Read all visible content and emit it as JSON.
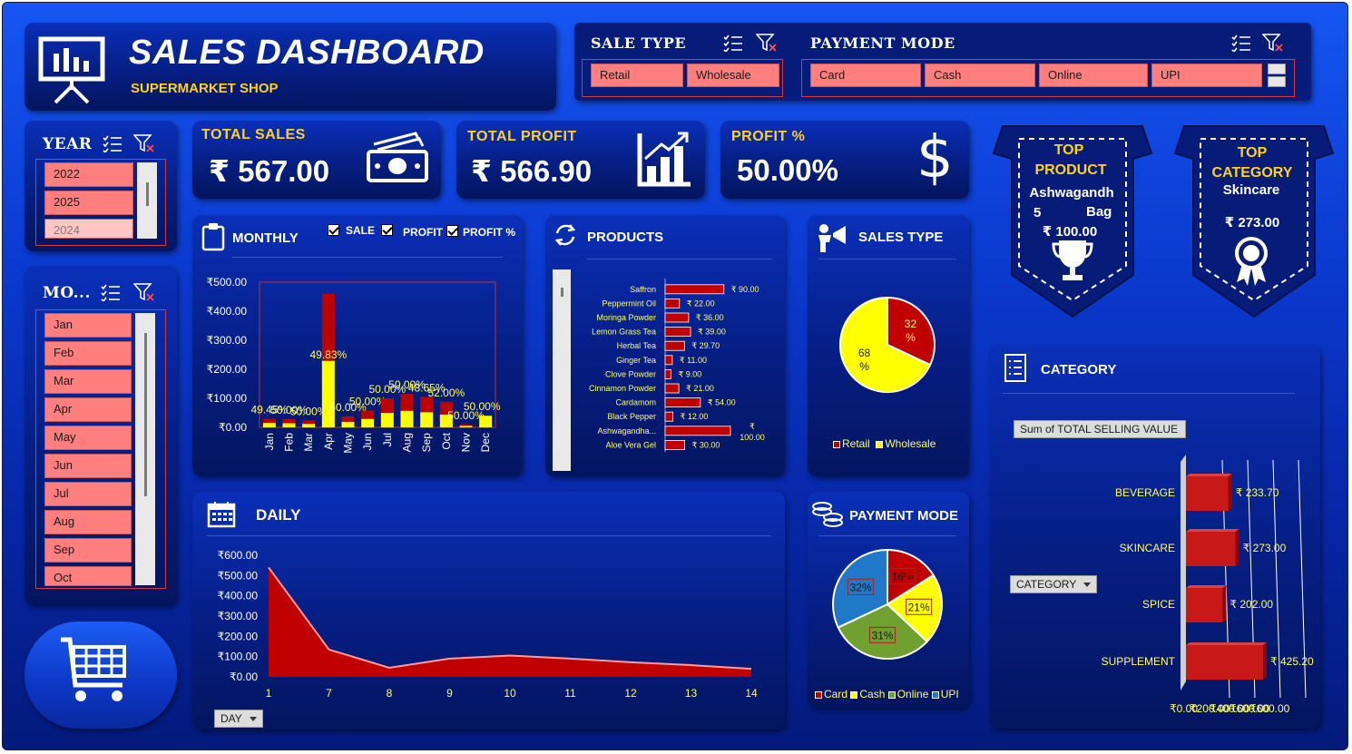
{
  "header": {
    "title": "SALES DASHBOARD",
    "subtitle": "SUPERMARKET SHOP"
  },
  "sale_type_slicer": {
    "title": "SALE TYPE",
    "items": [
      "Retail",
      "Wholesale"
    ]
  },
  "payment_mode_slicer": {
    "title": "PAYMENT MODE",
    "items": [
      "Card",
      "Cash",
      "Online",
      "UPI"
    ]
  },
  "year_slicer": {
    "title": "YEAR",
    "items": [
      "2022",
      "2025",
      "2024"
    ]
  },
  "month_slicer": {
    "title": "MO...",
    "items": [
      "Jan",
      "Feb",
      "Mar",
      "Apr",
      "May",
      "Jun",
      "Jul",
      "Aug",
      "Sep",
      "Oct"
    ]
  },
  "kpis": {
    "total_sales": {
      "label": "TOTAL SALES",
      "value": "₹ 567.00"
    },
    "total_profit": {
      "label": "TOTAL PROFIT",
      "value": "₹ 566.90"
    },
    "profit_pct": {
      "label": "PROFIT %",
      "value": "50.00%",
      "symbol": "$"
    }
  },
  "top_product": {
    "title_line1": "TOP",
    "title_line2": "PRODUCT",
    "name_line1": "Ashwagandh",
    "name_line2a": "5",
    "name_line2b": "Bag",
    "value": "₹ 100.00"
  },
  "top_category": {
    "title_line1": "TOP",
    "title_line2": "CATEGORY",
    "name": "Skincare",
    "value": "₹ 273.00"
  },
  "monthly": {
    "title": "MONTHLY",
    "checkboxes": [
      "SALE",
      "PROFIT",
      "PROFIT %"
    ]
  },
  "products_card": {
    "title": "PRODUCTS"
  },
  "sales_type_card": {
    "title": "SALES TYPE"
  },
  "payment_card": {
    "title": "PAYMENT MODE"
  },
  "daily_card": {
    "title": "DAILY",
    "field_button": "DAY"
  },
  "category_card": {
    "title": "CATEGORY",
    "field_label": "Sum of TOTAL SELLING VALUE",
    "field_button": "CATEGORY"
  },
  "colors": {
    "red": "#c00000",
    "yellow": "#ffff00",
    "accent": "#ffd21f",
    "slicer": "#ff7f7f",
    "green": "#70a030",
    "blue": "#1f78c8"
  },
  "chart_data": [
    {
      "type": "bar",
      "name_key": "monthly",
      "categories": [
        "Jan",
        "Feb",
        "Mar",
        "Apr",
        "May",
        "Jun",
        "Jul",
        "Aug",
        "Sep",
        "Oct",
        "Nov",
        "Dec"
      ],
      "series": [
        {
          "name": "SALE",
          "values": [
            30,
            28,
            24,
            460,
            38,
            58,
            100,
            115,
            105,
            88,
            10,
            40
          ]
        },
        {
          "name": "PROFIT",
          "values": [
            15,
            14,
            12,
            229,
            19,
            29,
            50,
            57,
            52,
            44,
            5,
            40
          ]
        }
      ],
      "data_labels": [
        "49.45%",
        "50.00%",
        "50.00%",
        "49.83%",
        "50.00%",
        "50.00%",
        "50.00%",
        "50.00%",
        "48.65%",
        "52.00%",
        "50.00%",
        "50.00%"
      ],
      "y_ticks": [
        "₹0.00",
        "₹100.00",
        "₹200.00",
        "₹300.00",
        "₹400.00",
        "₹500.00"
      ],
      "ylim": [
        0,
        500
      ]
    },
    {
      "type": "bar",
      "name_key": "products",
      "orientation": "horizontal",
      "categories": [
        "Saffron",
        "Peppermint Oil",
        "Moringa Powder",
        "Lemon Grass Tea",
        "Herbal Tea",
        "Ginger Tea",
        "Clove Powder",
        "Cinnamon Powder",
        "Cardamom",
        "Black Pepper",
        "Ashwagandha...",
        "Aloe Vera Gel"
      ],
      "values": [
        90,
        22,
        36,
        39,
        29.7,
        11,
        9,
        21,
        54,
        12,
        100,
        30
      ],
      "value_labels": [
        "₹ 90.00",
        "₹ 22.00",
        "₹ 36.00",
        "₹ 39.00",
        "₹ 29.70",
        "₹ 11.00",
        "₹ 9.00",
        "₹ 21.00",
        "₹ 54.00",
        "₹ 12.00",
        "₹ 100.00",
        "₹ 30.00"
      ],
      "xlim": [
        0,
        100
      ]
    },
    {
      "type": "pie",
      "name_key": "sales_type",
      "categories": [
        "Retail",
        "Wholesale"
      ],
      "values": [
        32,
        68
      ],
      "data_labels": [
        "32 %",
        "68 %"
      ],
      "colors": [
        "#c00000",
        "#ffff00"
      ]
    },
    {
      "type": "pie",
      "name_key": "payment",
      "categories": [
        "Card",
        "Cash",
        "Online",
        "UPI"
      ],
      "values": [
        16,
        21,
        31,
        32
      ],
      "data_labels": [
        "16%",
        "21%",
        "31%",
        "32%"
      ],
      "colors": [
        "#c00000",
        "#ffff00",
        "#70a030",
        "#1f78c8"
      ]
    },
    {
      "type": "area",
      "name_key": "daily",
      "categories": [
        "1",
        "7",
        "8",
        "9",
        "10",
        "11",
        "12",
        "13",
        "14"
      ],
      "values": [
        540,
        135,
        45,
        90,
        105,
        90,
        72,
        58,
        40
      ],
      "y_ticks": [
        "₹0.00",
        "₹100.00",
        "₹200.00",
        "₹300.00",
        "₹400.00",
        "₹500.00",
        "₹600.00"
      ],
      "ylim": [
        0,
        600
      ]
    },
    {
      "type": "bar",
      "name_key": "category",
      "orientation": "horizontal",
      "categories": [
        "BEVERAGE",
        "SKINCARE",
        "SPICE",
        "SUPPLEMENT"
      ],
      "values": [
        233.7,
        273,
        202,
        425.2
      ],
      "value_labels": [
        "₹ 233.70",
        "₹ 273.00",
        "₹ 202.00",
        "₹ 425.20"
      ],
      "x_ticks": [
        "₹0.00",
        "₹200.00",
        "₹400.00",
        "₹600.00",
        "₹600.00"
      ],
      "xlim": [
        0,
        800
      ]
    }
  ]
}
